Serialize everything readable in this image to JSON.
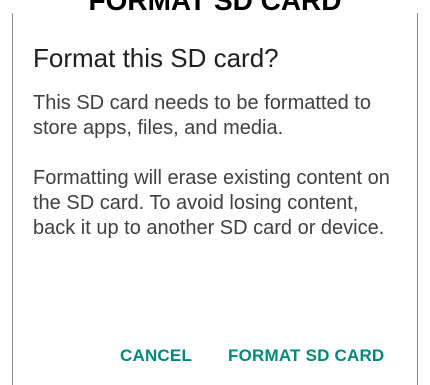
{
  "banner": {
    "text": "FORMAT SD CARD"
  },
  "dialog": {
    "title": "Format this SD card?",
    "paragraph_1": "This SD card needs to be formatted to store apps, files, and media.",
    "paragraph_2": "Formatting will erase existing content on the SD card. To avoid losing content, back it up to another SD card or device.",
    "actions": {
      "cancel_label": "CANCEL",
      "format_label": "FORMAT SD CARD"
    }
  },
  "colors": {
    "accent": "#00897b",
    "title": "#202020",
    "body": "#404040",
    "banner": "#000000"
  }
}
